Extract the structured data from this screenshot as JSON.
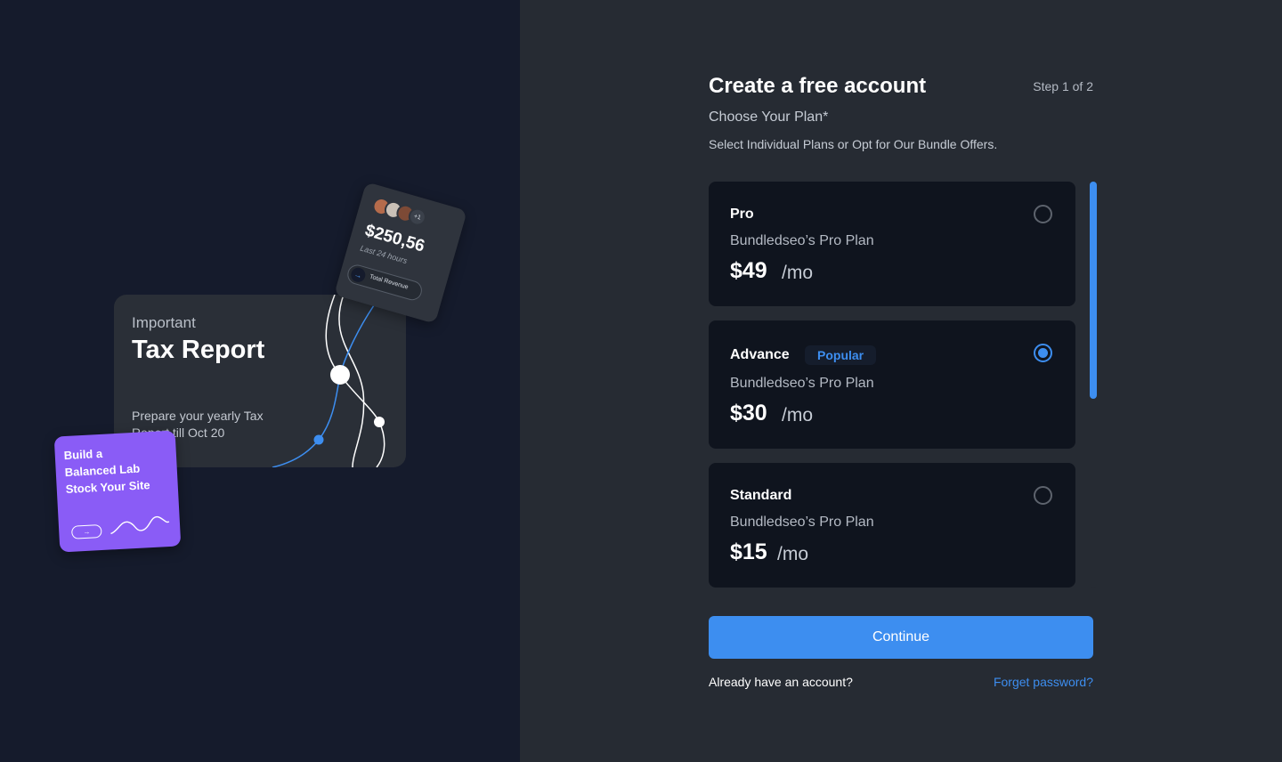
{
  "illustration": {
    "tax_card": {
      "kicker": "Important",
      "title": "Tax Report",
      "description": "Prepare your yearly Tax Report till Oct 20"
    },
    "revenue_card": {
      "avatars_more": "+1",
      "amount": "$250,56",
      "period": "Last 24 hours",
      "button_arrow": "→",
      "button_label": "Total Revenue"
    },
    "promo_card": {
      "text": "Build a Balanced Lab Stock Your Site",
      "button_arrow": "→"
    }
  },
  "form": {
    "title": "Create a free account",
    "step": "Step 1 of 2",
    "plan_heading": "Choose Your Plan*",
    "plan_subheading": "Select Individual Plans or Opt for Our Bundle Offers.",
    "plans": [
      {
        "name": "Pro",
        "badge": "",
        "description": "Bundledseo’s Pro Plan",
        "price": "$49",
        "period": "/mo",
        "selected": false
      },
      {
        "name": "Advance",
        "badge": "Popular",
        "description": "Bundledseo’s Pro Plan",
        "price": "$30",
        "period": "/mo",
        "selected": true
      },
      {
        "name": "Standard",
        "badge": "",
        "description": "Bundledseo’s Pro Plan",
        "price": "$15",
        "period": "/mo",
        "selected": false
      }
    ],
    "continue_label": "Continue",
    "login_prompt": "Already have an account?",
    "forgot_password_label": "Forget password?"
  },
  "colors": {
    "accent": "#3d8ef0",
    "left_background": "#151b2c",
    "right_background": "#262b33",
    "card_background": "#0f141e",
    "promo": "#8a5cf6"
  }
}
